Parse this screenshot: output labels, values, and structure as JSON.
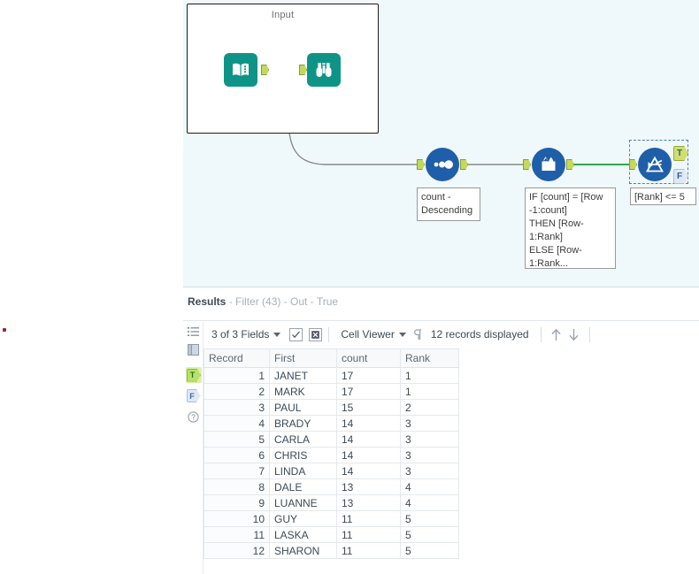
{
  "canvas": {
    "container": {
      "title": "Input"
    },
    "tools": [
      {
        "id": "directory",
        "icon": "book-icon",
        "kind": "macro"
      },
      {
        "id": "browse",
        "icon": "binoculars-icon",
        "kind": "macro"
      },
      {
        "id": "sort",
        "icon": "sort-icon",
        "kind": "tool",
        "annotation": "count -\nDescending"
      },
      {
        "id": "multirow",
        "icon": "multi-row-formula-icon",
        "kind": "tool",
        "annotation": "IF [count] = [Row\n-1:count]\nTHEN [Row-\n1:Rank]\nELSE [Row-\n1:Rank..."
      },
      {
        "id": "filter",
        "icon": "filter-icon",
        "kind": "tool",
        "annotation": "[Rank] <= 5",
        "outputs": [
          {
            "label": "T"
          },
          {
            "label": "F"
          }
        ],
        "selected": true
      }
    ]
  },
  "results": {
    "title_prefix": "Results",
    "title_parts": [
      " - ",
      "Filter (43)",
      " - ",
      "Out",
      " - ",
      "True"
    ],
    "toolbar": {
      "fields_label": "3 of 3 Fields",
      "select_all_icon": "checkbox-checked-icon",
      "deselect_all_icon": "checkbox-cross-icon",
      "viewer_label": "Cell Viewer",
      "pilcrow_icon": "pilcrow-icon",
      "record_count": "12 records displayed",
      "prev_icon": "arrow-up-icon",
      "next_icon": "arrow-down-icon"
    },
    "rail": [
      {
        "name": "field-list-icon",
        "glyph": "☰"
      },
      {
        "name": "columns-icon",
        "glyph": "▥"
      },
      {
        "name": "true-anchor-tag",
        "glyph": "T"
      },
      {
        "name": "false-anchor-tag",
        "glyph": "F"
      },
      {
        "name": "help-icon",
        "glyph": "?"
      }
    ],
    "table": {
      "columns": [
        "Record",
        "First",
        "count",
        "Rank"
      ],
      "rows": [
        [
          "1",
          "JANET",
          "17",
          "1"
        ],
        [
          "2",
          "MARK",
          "17",
          "1"
        ],
        [
          "3",
          "PAUL",
          "15",
          "2"
        ],
        [
          "4",
          "BRADY",
          "14",
          "3"
        ],
        [
          "5",
          "CARLA",
          "14",
          "3"
        ],
        [
          "6",
          "CHRIS",
          "14",
          "3"
        ],
        [
          "7",
          "LINDA",
          "14",
          "3"
        ],
        [
          "8",
          "DALE",
          "13",
          "4"
        ],
        [
          "9",
          "LUANNE",
          "13",
          "4"
        ],
        [
          "10",
          "GUY",
          "11",
          "5"
        ],
        [
          "11",
          "LASKA",
          "11",
          "5"
        ],
        [
          "12",
          "SHARON",
          "11",
          "5"
        ]
      ]
    }
  },
  "colors": {
    "macro_teal": "#0e9487",
    "tool_blue": "#1f5fa9",
    "canvas_bg": "#eff8fb",
    "anchor_green": "#c4d85c",
    "true_connection": "#159b3f",
    "selection_blue": "#4a7fc1"
  }
}
